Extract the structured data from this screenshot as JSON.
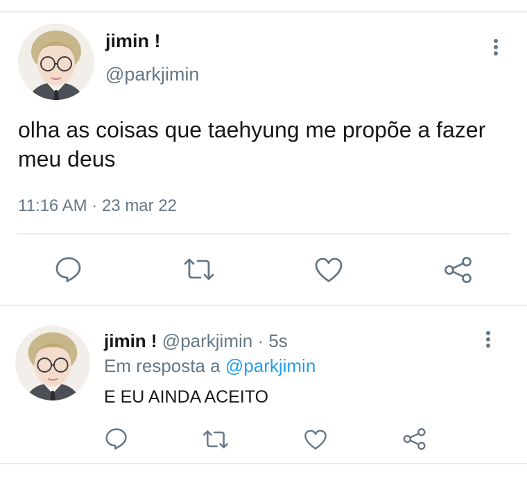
{
  "tweet": {
    "display_name": "jimin !",
    "handle": "@parkjimin",
    "text": "olha as coisas que taehyung me propõe a fazer meu deus",
    "timestamp": "11:16 AM · 23 mar 22",
    "avatar_icon": "avatar-photo-icon",
    "more_icon": "more-vertical-icon",
    "actions": [
      {
        "name": "reply",
        "icon": "speech-bubble-icon"
      },
      {
        "name": "retweet",
        "icon": "retweet-arrows-icon"
      },
      {
        "name": "like",
        "icon": "heart-icon"
      },
      {
        "name": "share",
        "icon": "share-nodes-icon"
      }
    ]
  },
  "reply": {
    "display_name": "jimin !",
    "handle": "@parkjimin",
    "time": "· 5s",
    "replying_prefix": "Em resposta a",
    "replying_mention": "@parkjimin",
    "text": "E EU AINDA ACEITO"
  },
  "colors": {
    "text": "#14171a",
    "secondary": "#657786",
    "link": "#1da1f2",
    "divider": "#e6ecf0"
  }
}
